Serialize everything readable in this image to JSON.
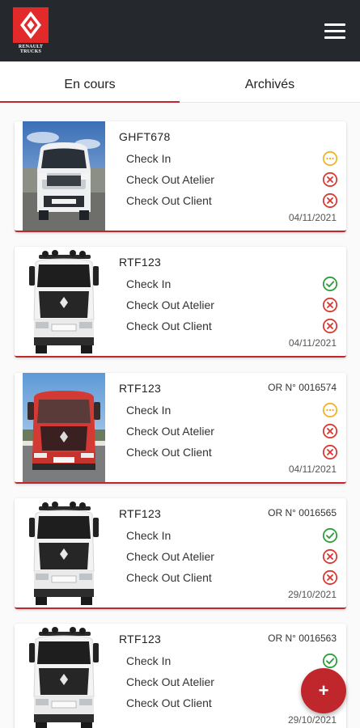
{
  "app": {
    "brand_name": "RENAULT TRUCKS",
    "logo_icon": "renault-diamond-logo",
    "menu_icon": "hamburger-menu-icon",
    "brand_color": "#e32a2a",
    "appbar_color": "#25292d"
  },
  "tabs": [
    {
      "label": "En cours",
      "active": true
    },
    {
      "label": "Archivés",
      "active": false
    }
  ],
  "status_colors": {
    "pending": "#f0b429",
    "done": "#2e9e3e",
    "rejected": "#d83a34"
  },
  "cards": [
    {
      "plate": "GHFT678",
      "or_number": "",
      "photo": "white-van-photo",
      "checks": [
        {
          "label": "Check In",
          "status": "pending",
          "icon": "more-horizontal-circle-icon"
        },
        {
          "label": "Check Out Atelier",
          "status": "rejected",
          "icon": "x-circle-icon"
        },
        {
          "label": "Check Out Client",
          "status": "rejected",
          "icon": "x-circle-icon"
        }
      ],
      "date": "04/11/2021"
    },
    {
      "plate": "RTF123",
      "or_number": "",
      "photo": "white-truck-cab-photo",
      "checks": [
        {
          "label": "Check In",
          "status": "done",
          "icon": "check-circle-icon"
        },
        {
          "label": "Check Out Atelier",
          "status": "rejected",
          "icon": "x-circle-icon"
        },
        {
          "label": "Check Out Client",
          "status": "rejected",
          "icon": "x-circle-icon"
        }
      ],
      "date": "04/11/2021"
    },
    {
      "plate": "RTF123",
      "or_number": "OR N° 0016574",
      "photo": "red-truck-photo",
      "checks": [
        {
          "label": "Check In",
          "status": "pending",
          "icon": "more-horizontal-circle-icon"
        },
        {
          "label": "Check Out Atelier",
          "status": "rejected",
          "icon": "x-circle-icon"
        },
        {
          "label": "Check Out Client",
          "status": "rejected",
          "icon": "x-circle-icon"
        }
      ],
      "date": "04/11/2021"
    },
    {
      "plate": "RTF123",
      "or_number": "OR N° 0016565",
      "photo": "white-truck-cab-photo",
      "checks": [
        {
          "label": "Check In",
          "status": "done",
          "icon": "check-circle-icon"
        },
        {
          "label": "Check Out Atelier",
          "status": "rejected",
          "icon": "x-circle-icon"
        },
        {
          "label": "Check Out Client",
          "status": "rejected",
          "icon": "x-circle-icon"
        }
      ],
      "date": "29/10/2021"
    },
    {
      "plate": "RTF123",
      "or_number": "OR N° 0016563",
      "photo": "white-truck-cab-photo",
      "checks": [
        {
          "label": "Check In",
          "status": "done",
          "icon": "check-circle-icon"
        },
        {
          "label": "Check Out Atelier",
          "status": "rejected",
          "icon": "x-circle-icon"
        },
        {
          "label": "Check Out Client",
          "status": "rejected",
          "icon": "x-circle-icon"
        }
      ],
      "date": "29/10/2021"
    }
  ],
  "fab": {
    "label": "+",
    "icon": "plus-icon"
  }
}
